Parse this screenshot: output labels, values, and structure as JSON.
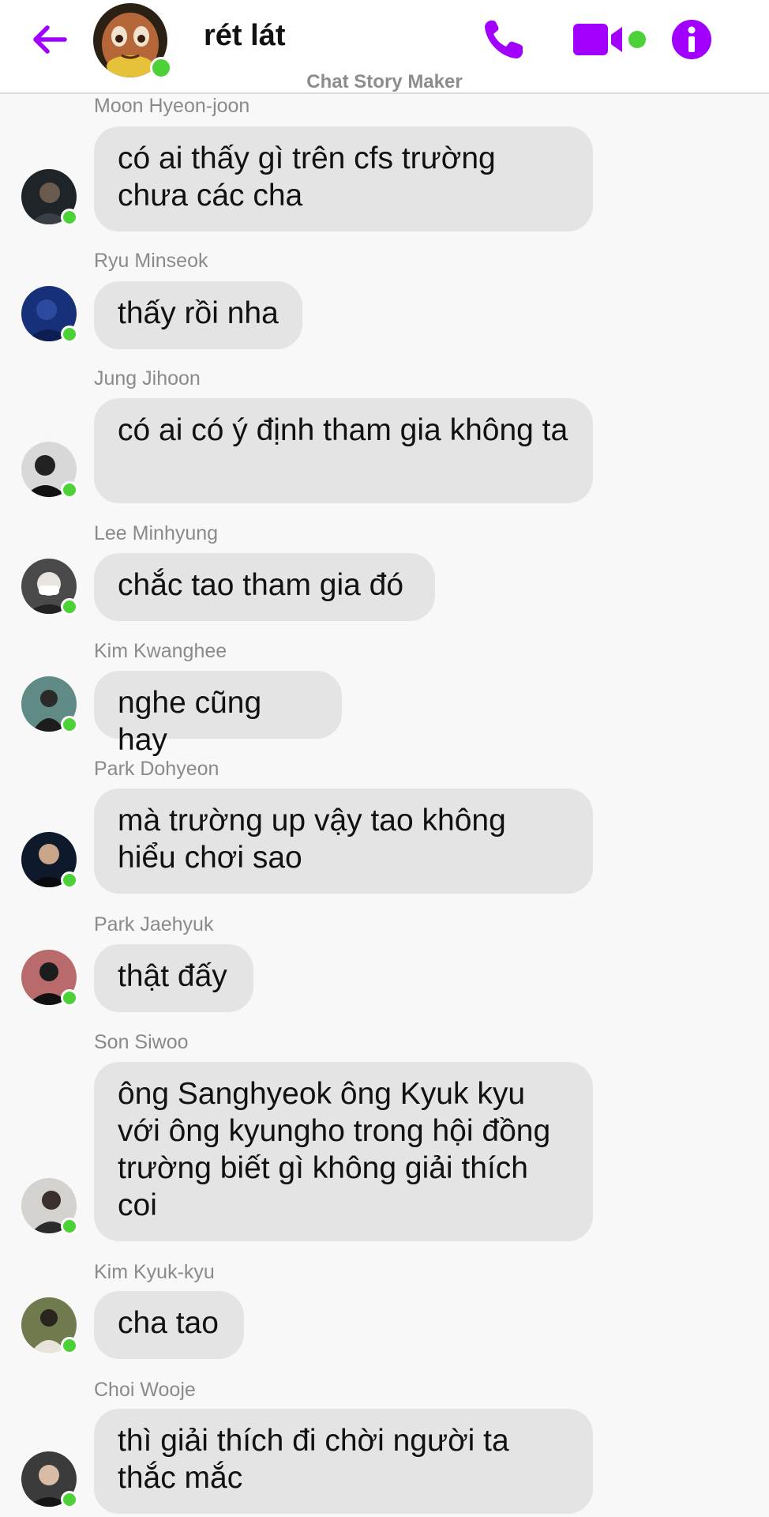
{
  "header": {
    "title": "rét lát",
    "watermark": "Chat Story Maker",
    "back_icon": "arrow-left-icon",
    "call_icon": "phone-icon",
    "video_icon": "video-camera-icon",
    "info_icon": "info-icon",
    "accent_color": "#a100ff",
    "online_color": "#4cd137"
  },
  "messages": [
    {
      "sender": "Moon Hyeon-joon",
      "text": "có ai thấy gì trên cfs trường chưa các cha"
    },
    {
      "sender": "Ryu Minseok",
      "text": "thấy rồi nha"
    },
    {
      "sender": "Jung Jihoon",
      "text": "có ai có ý định tham gia không ta"
    },
    {
      "sender": "Lee Minhyung",
      "text": "chắc tao tham gia đó"
    },
    {
      "sender": "Kim Kwanghee",
      "text": "nghe cũng hay"
    },
    {
      "sender": "Park Dohyeon",
      "text": "mà trường up vậy tao không hiểu chơi sao"
    },
    {
      "sender": "Park Jaehyuk",
      "text": "thật đấy"
    },
    {
      "sender": "Son Siwoo",
      "text": "ông Sanghyeok ông Kyuk kyu với ông kyungho trong hội đồng trường biết gì không giải thích coi"
    },
    {
      "sender": "Kim Kyuk-kyu",
      "text": "cha tao"
    },
    {
      "sender": "Choi Wooje",
      "text": "thì giải thích đi chời người ta thắc mắc"
    }
  ]
}
